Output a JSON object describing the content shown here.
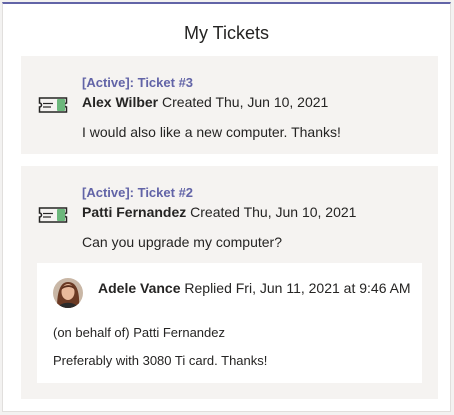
{
  "header": {
    "title": "My Tickets"
  },
  "tickets": [
    {
      "status": "[Active]: Ticket #3",
      "author": "Alex Wilber",
      "meta": "Created Thu, Jun 10, 2021",
      "message": "I would also like a new computer. Thanks!"
    },
    {
      "status": "[Active]: Ticket #2",
      "author": "Patti Fernandez",
      "meta": "Created Thu, Jun 10, 2021",
      "message": "Can you upgrade my computer?",
      "reply": {
        "author": "Adele Vance",
        "meta": "Replied Fri, Jun 11, 2021 at 9:46 AM",
        "on_behalf": "(on behalf of) Patti Fernandez",
        "text": "Preferably with 3080 Ti card. Thanks!"
      }
    }
  ],
  "colors": {
    "accent": "#6264a7",
    "ticket_bg": "#f5f3f1",
    "icon_green": "#6bb77b"
  },
  "icons": {
    "ticket": "ticket-icon",
    "avatar": "avatar-photo"
  }
}
